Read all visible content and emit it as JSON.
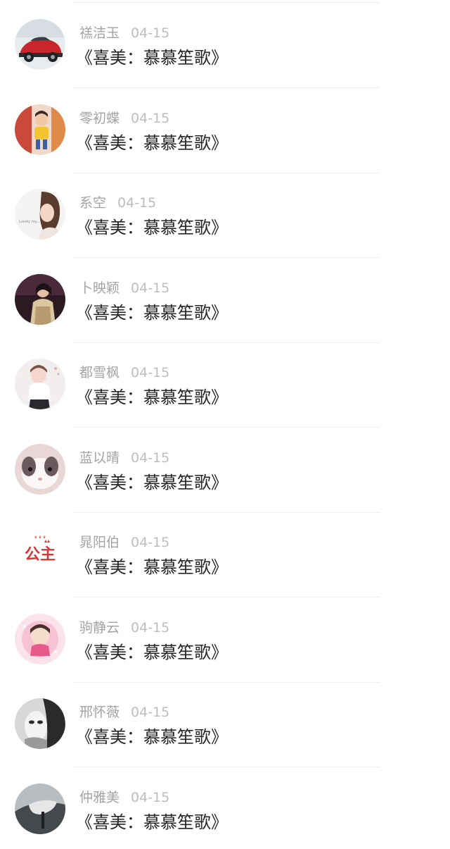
{
  "feed": {
    "items": [
      {
        "name": "禚洁玉",
        "date": "04-15",
        "title": "《喜美：慕慕笙歌》",
        "avatar": "red-sports-car-avatar"
      },
      {
        "name": "零初蝶",
        "date": "04-15",
        "title": "《喜美：慕慕笙歌》",
        "avatar": "child-in-yellow-avatar"
      },
      {
        "name": "系空",
        "date": "04-15",
        "title": "《喜美：慕慕笙歌》",
        "avatar": "girl-portrait-avatar"
      },
      {
        "name": "卜映颖",
        "date": "04-15",
        "title": "《喜美：慕慕笙歌》",
        "avatar": "woman-dark-photo-avatar"
      },
      {
        "name": "都雪枫",
        "date": "04-15",
        "title": "《喜美：慕慕笙歌》",
        "avatar": "little-girl-avatar"
      },
      {
        "name": "蓝以晴",
        "date": "04-15",
        "title": "《喜美：慕慕笙歌》",
        "avatar": "white-rabbit-avatar"
      },
      {
        "name": "晁阳伯",
        "date": "04-15",
        "title": "《喜美：慕慕笙歌》",
        "avatar": "princess-text-avatar",
        "avatar_text": "公主"
      },
      {
        "name": "驹静云",
        "date": "04-15",
        "title": "《喜美：慕慕笙歌》",
        "avatar": "pink-baby-avatar"
      },
      {
        "name": "邢怀薇",
        "date": "04-15",
        "title": "《喜美：慕慕笙歌》",
        "avatar": "masked-figure-avatar"
      },
      {
        "name": "仲雅美",
        "date": "04-15",
        "title": "《喜美：慕慕笙歌》",
        "avatar": "grey-hand-avatar"
      }
    ]
  }
}
